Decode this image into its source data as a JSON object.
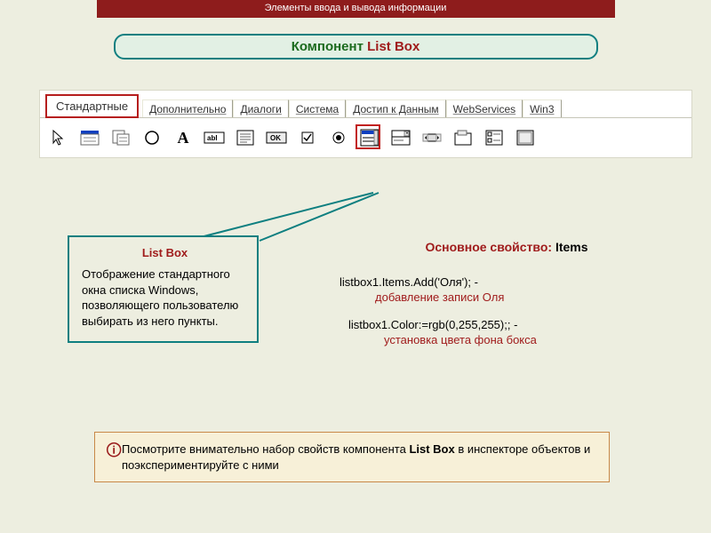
{
  "header": "Элементы ввода и вывода информации",
  "title": {
    "prefix": "Компонент ",
    "accent": "List Box"
  },
  "tabs": [
    "Стандартные",
    "Дополнительно",
    "Диалоги",
    "Система",
    "Достип к Данным",
    "WebServices",
    "Win3"
  ],
  "activeTab": 0,
  "iconNames": [
    "cursor",
    "menu",
    "popup-menu",
    "circle",
    "letter-a",
    "edit-field",
    "memo",
    "ok-button",
    "checkbox",
    "radio",
    "listbox",
    "combobox",
    "scrollbar",
    "groupbox",
    "checklistbox",
    "panel"
  ],
  "highlightIndex": 10,
  "info": {
    "heading": "List Box",
    "body": "Отображение стандартного окна списка Windows, позволяющего пользователю выбирать из него пункты."
  },
  "right": {
    "propLabel": "Основное свойство:",
    "propName": " Items",
    "code1_black": "listbox1.Items.Add('Оля'); - ",
    "code1_red": "добавление записи Оля",
    "code2_black": "listbox1.Color:=rgb(0,255,255);; - ",
    "code2_red": "установка цвета фона бокса"
  },
  "tip": {
    "t1": "Посмотрите внимательно набор свойств компонента ",
    "bold": "List Box",
    "t2": " в инспекторе объектов и поэкспериментируйте с ними"
  }
}
